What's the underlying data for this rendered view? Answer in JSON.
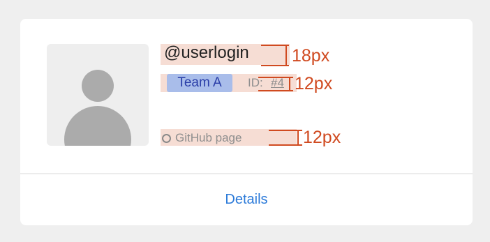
{
  "profile": {
    "login": "@userlogin",
    "team": "Team A",
    "id_label": "ID:",
    "id_value": "#4",
    "github_label": "GitHub page"
  },
  "footer": {
    "details_label": "Details"
  },
  "annotations": {
    "login_size": "18px",
    "badge_size": "12px",
    "github_size": "12px"
  },
  "colors": {
    "background": "#efefef",
    "card": "#ffffff",
    "link": "#2b7ad9",
    "annotation": "#d04a20",
    "badge_bg": "#a9bdea",
    "badge_text": "#2a3ea8"
  },
  "icons": {
    "avatar": "user-avatar-placeholder-icon",
    "github": "github-icon"
  }
}
